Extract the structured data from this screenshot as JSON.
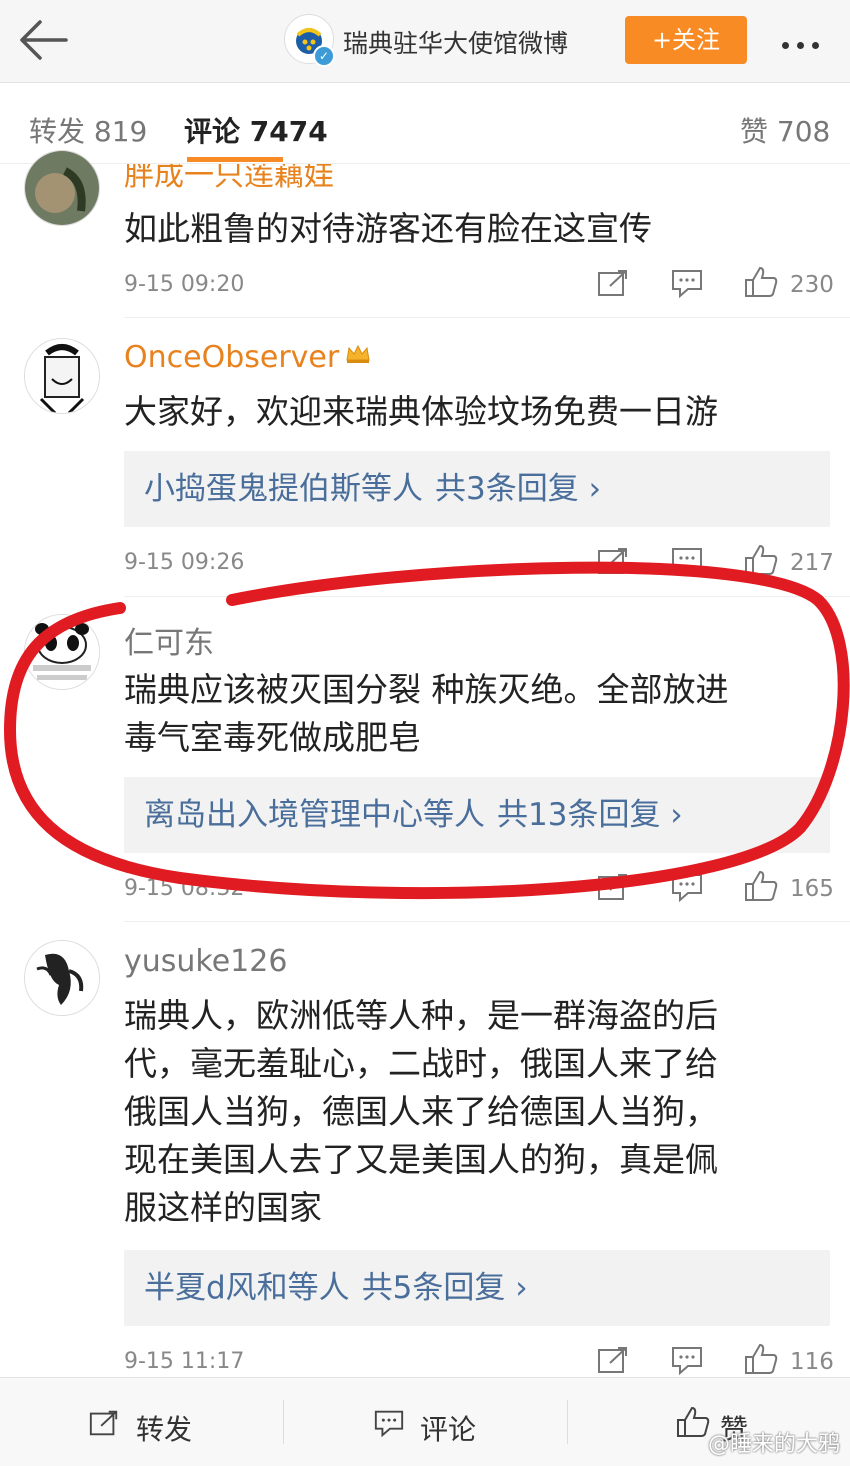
{
  "header": {
    "title": "瑞典驻华大使馆微博",
    "follow_label": "+关注"
  },
  "tabs": {
    "repost": "转发 819",
    "comment": "评论 7474",
    "like": "赞 708"
  },
  "comments": [
    {
      "username": "胖成一只莲藕娃",
      "text": "如此粗鲁的对待游客还有脸在这宣传",
      "time": "9-15 09:20",
      "likes": "230"
    },
    {
      "username": "OnceObserver",
      "text": "大家好，欢迎来瑞典体验坟场免费一日游",
      "reply_users": "小捣蛋鬼提伯斯等人",
      "reply_more": "共3条回复 ›",
      "time": "9-15 09:26",
      "likes": "217"
    },
    {
      "username": "仁可东",
      "text_line1": "瑞典应该被灭国分裂 种族灭绝。全部放进",
      "text_line2": "毒气室毒死做成肥皂",
      "reply_users": "离岛出入境管理中心等人",
      "reply_more": "共13条回复 ›",
      "time": "9-15 08:32",
      "likes": "165"
    },
    {
      "username": "yusuke126",
      "text_lines": [
        "瑞典人，欧洲低等人种，是一群海盗的后",
        "代，毫无羞耻心，二战时，俄国人来了给",
        "俄国人当狗，德国人来了给德国人当狗，",
        "现在美国人去了又是美国人的狗，真是佩",
        "服这样的国家"
      ],
      "reply_users": "半夏d风和等人",
      "reply_more": "共5条回复 ›",
      "time": "9-15 11:17",
      "likes": "116"
    }
  ],
  "bottom_bar": {
    "repost": "转发",
    "comment": "评论",
    "like": "赞"
  },
  "watermark": "@睡来的大鸦",
  "colors": {
    "accent": "#f98b25",
    "username_vip": "#e8821e",
    "link": "#4a6e9b",
    "annotation": "#e11b22"
  }
}
